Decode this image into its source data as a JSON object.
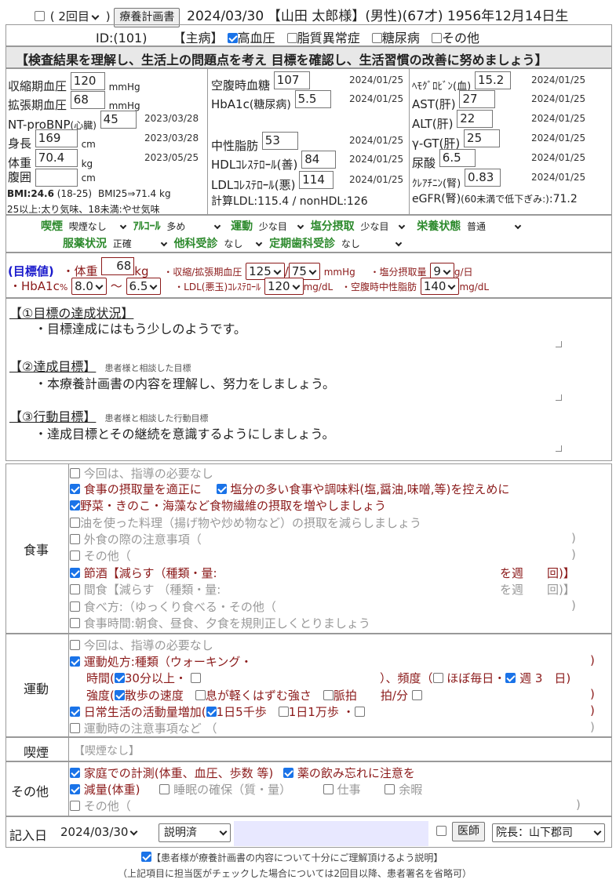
{
  "header": {
    "visit_select": "( 2回目",
    "plan_button": "療養計画書",
    "date": "2024/03/30",
    "patient": "【山田 太郎様】(男性)(67才) 1956年12月14日生"
  },
  "disease": {
    "id": "ID:(101)",
    "main_label": "【主病】",
    "items": [
      "高血圧",
      "脂質異常症",
      "糖尿病",
      "その他"
    ]
  },
  "banner": "【検査結果を理解し、生活上の問題点を考え 目標を確認し、生活習慣の改善に努めましょう】",
  "exam": {
    "sbp": {
      "label": "収縮期血圧",
      "value": "120",
      "unit": "mmHg"
    },
    "dbp": {
      "label": "拡張期血圧",
      "value": "68",
      "unit": "mmHg"
    },
    "bnp": {
      "label": "NT-proBNP",
      "sub": "(心臓)",
      "value": "45",
      "date": "2023/03/28"
    },
    "height": {
      "label": "身長",
      "value": "169",
      "unit": "cm",
      "date": "2023/03/28"
    },
    "weight": {
      "label": "体重",
      "value": "70.4",
      "unit": "kg",
      "date": "2023/05/25"
    },
    "waist": {
      "label": "腹囲",
      "value": "",
      "unit": "cm"
    },
    "bmi": {
      "label": "BMI:24.6",
      "range": " (18-25)",
      "target": "BMI25⇒71.4 kg"
    },
    "bmi_note": "25以上:太り気味、18未満:やせ気味",
    "fbs": {
      "label": "空腹時血糖",
      "value": "107",
      "date": "2024/01/25"
    },
    "hba1c": {
      "label": "HbA1c",
      "sub": "(糖尿病)",
      "value": "5.5",
      "date": "2024/01/25"
    },
    "tg": {
      "label": "中性脂肪",
      "value": "53",
      "date": "2024/01/25"
    },
    "hdl": {
      "label": "HDLｺﾚｽﾃﾛｰﾙ(善)",
      "value": "84",
      "date": "2024/01/25"
    },
    "ldl": {
      "label": "LDLｺﾚｽﾃﾛｰﾙ(悪)",
      "value": "114",
      "date": "2024/01/25"
    },
    "calc": "計算LDL:115.4 / nonHDL:126",
    "hb": {
      "label": "ﾍﾓｸﾞﾛﾋﾞﾝ(血)",
      "value": "15.2",
      "date": "2024/01/25"
    },
    "ast": {
      "label": "AST(肝)",
      "value": "27",
      "date": "2024/01/25"
    },
    "alt": {
      "label": "ALT(肝)",
      "value": "22",
      "date": "2024/01/25"
    },
    "ggt": {
      "label": "γ-GT(肝)",
      "value": "25",
      "date": "2024/01/25"
    },
    "ua": {
      "label": "尿酸",
      "value": "6.5",
      "date": "2024/01/25"
    },
    "cre": {
      "label": "ｸﾚｱﾁﾆﾝ(腎)",
      "value": "0.83",
      "date": "2024/01/25"
    },
    "egfr": {
      "label": "eGFR(腎)",
      "sub": "(60未満で低下ぎみ:)",
      "value": ":71.2"
    }
  },
  "habits": {
    "smoke": {
      "label": "喫煙",
      "value": "喫煙なし"
    },
    "alcohol": {
      "label": "ｱﾙｺｰﾙ",
      "value": "多め"
    },
    "exercise": {
      "label": "運動",
      "value": "少な目"
    },
    "salt": {
      "label": "塩分摂取",
      "value": "少な目"
    },
    "nutrition": {
      "label": "栄養状態",
      "value": "普通"
    },
    "meds": {
      "label": "服薬状況",
      "value": "正確"
    },
    "other_dept": {
      "label": "他科受診",
      "value": "なし"
    },
    "dental": {
      "label": "定期歯科受診",
      "value": "なし"
    }
  },
  "targets": {
    "label": "(目標値)",
    "weight_label": "・体重",
    "weight": "68",
    "weight_unit": "kg",
    "bp_label": "・収縮/拡張期血圧",
    "sbp": "125",
    "dbp": "75",
    "bp_unit": "mmHg",
    "salt_label": "・塩分摂取量",
    "salt": "9",
    "salt_unit": "g/日",
    "hba1c_label": "・HbA1c",
    "hba1c_pct": "%",
    "hba1c_low": "8.0",
    "tilde": "～",
    "hba1c_high": "6.5",
    "ldl_label": "・LDL(悪玉)ｺﾚｽﾃﾛｰﾙ",
    "ldl": "120",
    "ldl_unit": "mg/dL",
    "tg_label": "・空腹時中性脂肪",
    "tg": "140",
    "tg_unit": "mg/dL"
  },
  "goals": [
    {
      "title": "【①目標の達成状況】",
      "note": "",
      "text": "・目標達成にはもう少しのようです。"
    },
    {
      "title": "【②達成目標】",
      "note": "患者様と相談した目標",
      "text": "・本療養計画書の内容を理解し、努力をしましょう。"
    },
    {
      "title": "【③行動目標】",
      "note": "患者様と相談した行動目標",
      "text": "・達成目標とその継続を意識するようにしましょう。"
    }
  ],
  "diet": {
    "label": "食事",
    "items": [
      {
        "text": "今回は、指導の必要なし",
        "on": false
      },
      {
        "text": "食事の摂取量を適正に",
        "on": true
      },
      {
        "text": "塩分の多い食事や調味料(塩,醤油,味噌,等)を控えめに",
        "on": true
      },
      {
        "text": "野菜・きのこ・海藻など食物繊維の摂取を増やしましょう",
        "on": true
      },
      {
        "text": "油を使った料理（揚げ物や炒め物など）の摂取を減らしましょう",
        "on": false
      },
      {
        "text": "外食の際の注意事項（",
        "on": false
      },
      {
        "text": "その他（",
        "on": false
      },
      {
        "text": "節酒【減らす（種類・量:",
        "on": true
      },
      {
        "text": "間食【減らす （種類・量:",
        "on": false
      },
      {
        "text": "食べ方:（ゆっくり食べる・その他（",
        "on": false
      },
      {
        "text": "食事時間:朝食、昼食、夕食を規則正しくとりましょう",
        "on": false
      }
    ],
    "week": "を週　　回)】",
    "close": ")"
  },
  "exercise": {
    "label": "運動",
    "none": "今回は、指導の必要なし",
    "prescription": "運動処方:種類（ウォーキング・",
    "time_label": "時間(",
    "time_opt": "30分以上・",
    "freq_label": "）、頻度（",
    "freq_daily": "ほぼ毎日・",
    "freq_week": "週 3　日)",
    "intensity_label": "強度(",
    "int1": "散歩の速度",
    "int2": "息が軽くはずむ強さ",
    "int3": "脈拍　　拍/分",
    "daily": "日常生活の活動量増加(",
    "step1": "1日5千歩",
    "step2": "1日1万歩 ・",
    "caution": "運動時の注意事項など （",
    "close": ")"
  },
  "smoking": {
    "label": "喫煙",
    "value": "【喫煙なし】"
  },
  "others": {
    "label": "その他",
    "items": [
      {
        "text": "家庭での計測(体重、血圧、歩数 等)",
        "on": true
      },
      {
        "text": "薬の飲み忘れに注意を",
        "on": true
      },
      {
        "text": "減量(体重)",
        "on": true
      },
      {
        "text": "睡眠の確保（質・量）",
        "on": false
      },
      {
        "text": "仕事",
        "on": false
      },
      {
        "text": "余暇",
        "on": false
      },
      {
        "text": "その他（",
        "on": false
      }
    ],
    "close": ")"
  },
  "footer": {
    "date_label": "記入日",
    "date": "2024/03/30",
    "status": "説明済",
    "doctor_button": "医師",
    "doctor": "院長：山下郡司",
    "consent": "【患者様が療養計画書の内容について十分にご理解頂けるよう説明】",
    "note": "（上記項目に担当医がチェックした場合については2回目以降、患者署名を省略可）"
  }
}
